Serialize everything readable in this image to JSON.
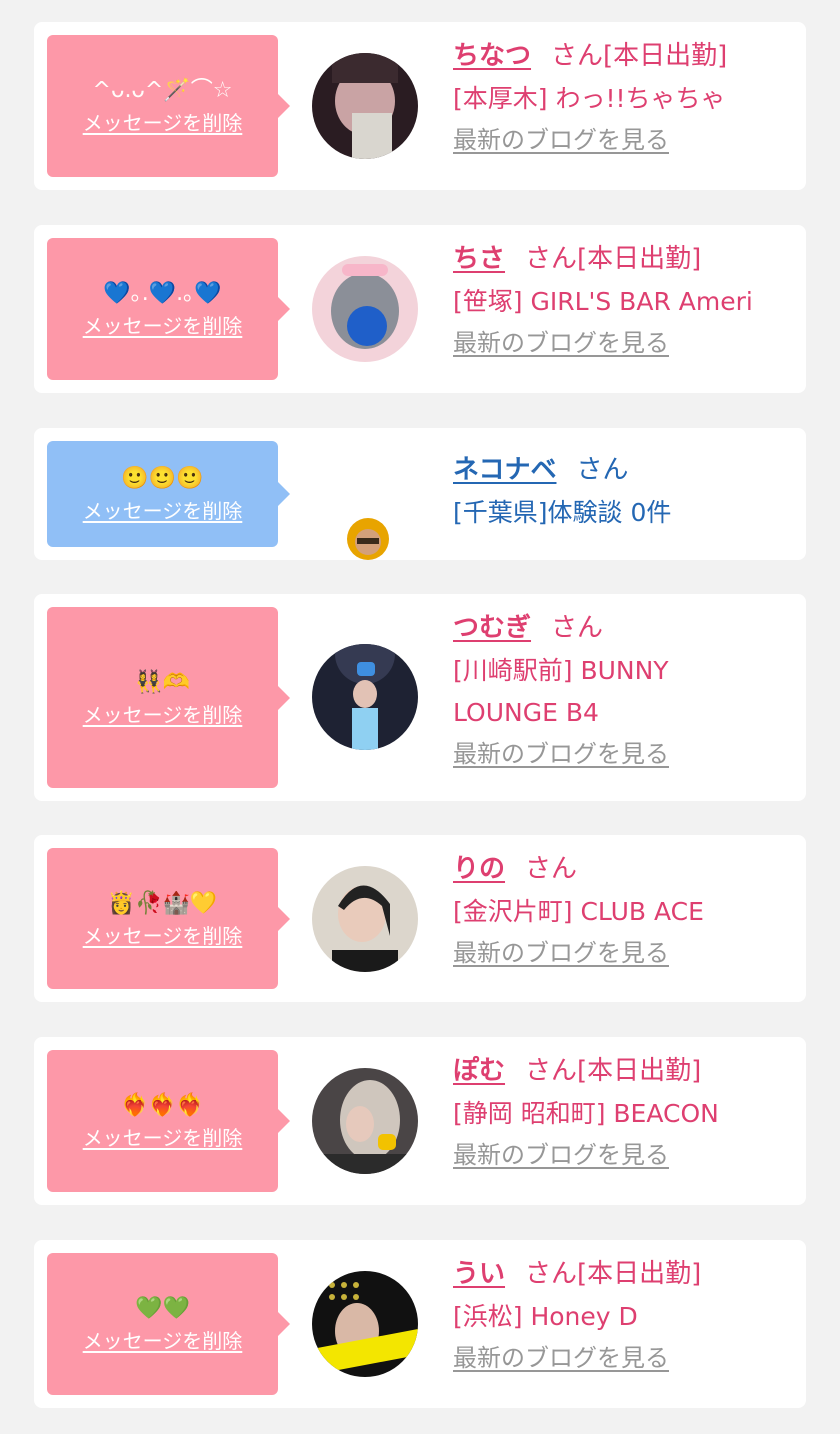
{
  "delete_label": "メッセージを削除",
  "blog_label": "最新のブログを見る",
  "suffix": "さん",
  "colors": {
    "pink_bubble": "#fd98a8",
    "blue_bubble": "#90bff6",
    "name_pink": "#de3f70",
    "name_blue": "#2467b3"
  },
  "items": [
    {
      "message": "^ᴗ.ᴗ^🪄⌒☆",
      "name": "ちなつ",
      "status": "[本日出勤]",
      "shop": "[本厚木] わっ!!ちゃちゃ",
      "has_blog": true,
      "bubble": "pink"
    },
    {
      "message": "💙｡.💙.｡💙",
      "name": "ちさ",
      "status": "[本日出勤]",
      "shop": "[笹塚] GIRL'S BAR Ameri",
      "has_blog": true,
      "bubble": "pink"
    },
    {
      "message": "🙂🙂🙂",
      "name": "ネコナベ",
      "status": "",
      "shop": "[千葉県]体験談 0件",
      "has_blog": false,
      "bubble": "blue"
    },
    {
      "message": "👯‍♀️🫶",
      "name": "つむぎ",
      "status": "",
      "shop": "[川崎駅前] BUNNY LOUNGE B4",
      "has_blog": true,
      "bubble": "pink"
    },
    {
      "message": "👸🥀🏰💛",
      "name": "りの",
      "status": "",
      "shop": "[金沢片町] CLUB ACE",
      "has_blog": true,
      "bubble": "pink"
    },
    {
      "message": "❤️‍🔥❤️‍🔥❤️‍🔥",
      "name": "ぽむ",
      "status": "[本日出勤]",
      "shop": "[静岡 昭和町] BEACON",
      "has_blog": true,
      "bubble": "pink"
    },
    {
      "message": "💚💚",
      "name": "うい",
      "status": "[本日出勤]",
      "shop": "[浜松] Honey D",
      "has_blog": true,
      "bubble": "pink"
    }
  ]
}
